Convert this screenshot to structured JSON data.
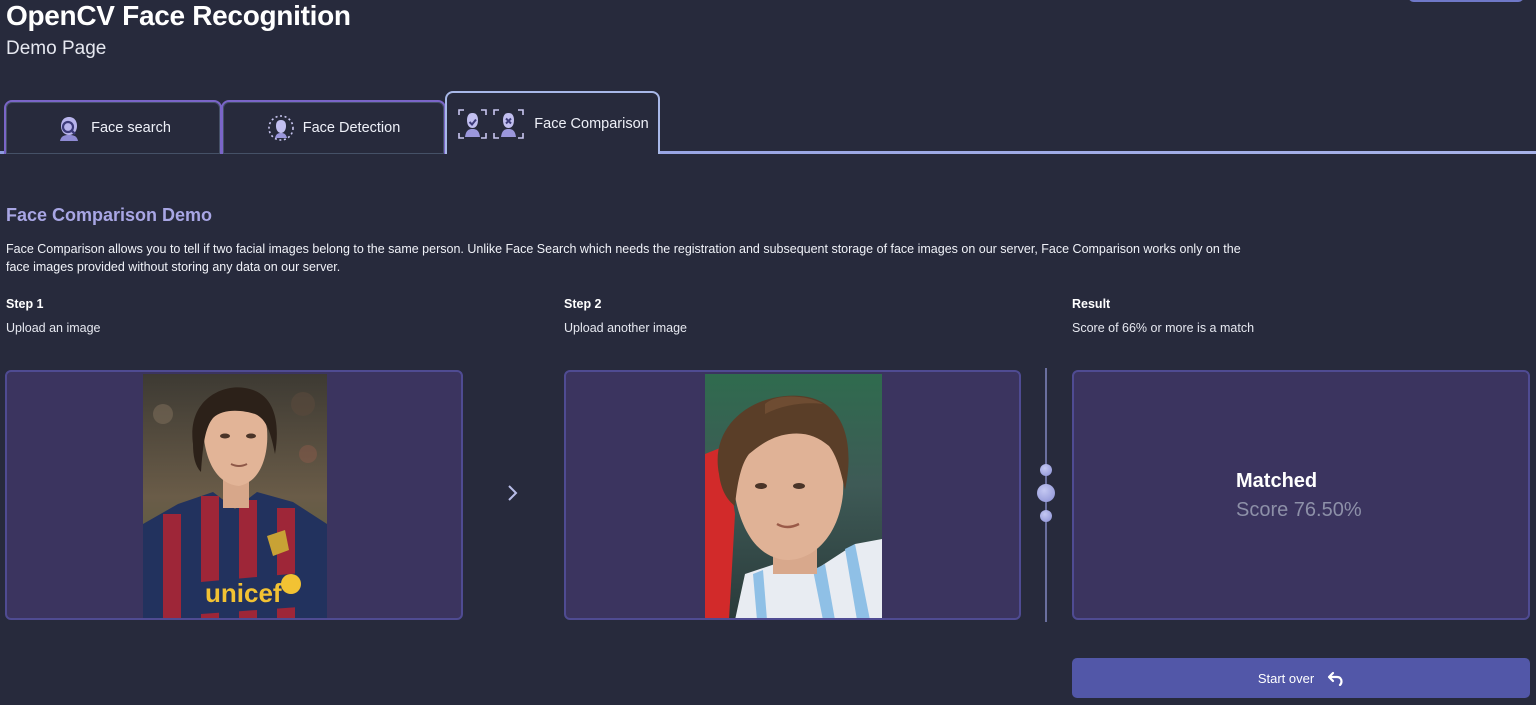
{
  "header": {
    "title": "OpenCV Face Recognition",
    "subtitle": "Demo Page"
  },
  "tabs": [
    {
      "label": "Face search",
      "icon": "face-search-icon",
      "active": false
    },
    {
      "label": "Face Detection",
      "icon": "face-detection-icon",
      "active": false
    },
    {
      "label": "Face Comparison",
      "icon": "face-comparison-icon",
      "active": true
    }
  ],
  "main": {
    "title": "Face Comparison Demo",
    "description": "Face Comparison allows you to tell if two facial images belong to the same person. Unlike Face Search which needs the registration and subsequent storage of face images on our server, Face Comparison works only on the face images provided without storing any data on our server.",
    "step1": {
      "label": "Step 1",
      "sub": "Upload an image"
    },
    "step2": {
      "label": "Step 2",
      "sub": "Upload another image"
    },
    "result": {
      "label": "Result",
      "sub": "Score of 66% or more is a match",
      "status": "Matched",
      "score": "Score 76.50%"
    },
    "start_over": "Start over"
  },
  "colors": {
    "background": "#272a3c",
    "panel": "#3b345f",
    "accent": "#5257a8",
    "section_title": "#a8a6e4"
  }
}
